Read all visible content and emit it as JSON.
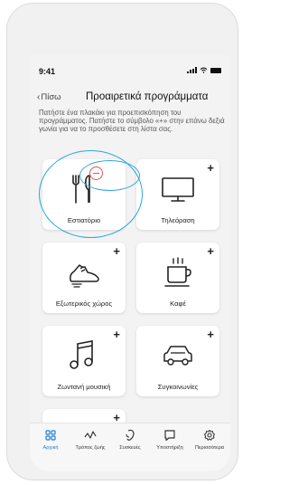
{
  "status": {
    "time": "9:41"
  },
  "nav": {
    "back_label": "Πίσω",
    "title": "Προαιρετικά προγράμματα"
  },
  "description": "Πατήστε ένα πλακάκι για προεπισκόπηση του προγράμματος. Πατήστε το σύμβολο «+» στην επάνω δεξιά γωνία για να το προσθέσετε στη λίστα σας.",
  "tiles": [
    {
      "label": "Εστιατόριο",
      "icon": "restaurant-icon",
      "action": "remove"
    },
    {
      "label": "Τηλεόραση",
      "icon": "tv-icon",
      "action": "add"
    },
    {
      "label": "Εξωτερικός χώρος",
      "icon": "shoe-icon",
      "action": "add"
    },
    {
      "label": "Καφέ",
      "icon": "coffee-icon",
      "action": "add"
    },
    {
      "label": "Ζωντανή μουσική",
      "icon": "music-note-icon",
      "action": "add"
    },
    {
      "label": "Συγκοινωνίες",
      "icon": "car-icon",
      "action": "add"
    }
  ],
  "add_symbol": "+",
  "tabbar": [
    {
      "label": "Αρχική",
      "icon": "home-grid-icon",
      "active": true
    },
    {
      "label": "Τρόπος ζωής",
      "icon": "lifestyle-icon",
      "active": false
    },
    {
      "label": "Συσκευές",
      "icon": "hearing-aid-icon",
      "active": false
    },
    {
      "label": "Υποστήριξη",
      "icon": "chat-bubble-icon",
      "active": false
    },
    {
      "label": "Περισσότερα",
      "icon": "gear-icon",
      "active": false
    }
  ],
  "colors": {
    "accent": "#1a7fd0",
    "highlight": "#2aa4e2",
    "remove": "#e35353"
  }
}
